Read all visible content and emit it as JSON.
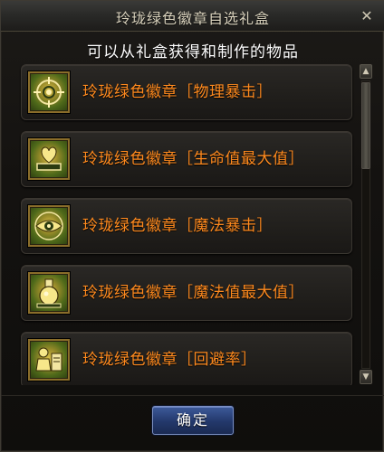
{
  "window": {
    "title": "玲珑绿色徽章自选礼盒",
    "close_glyph": "✕"
  },
  "subtitle": "可以从礼盒获得和制作的物品",
  "items": [
    {
      "label": "玲珑绿色徽章［物理暴击］",
      "icon": "crosshair-icon"
    },
    {
      "label": "玲珑绿色徽章［生命值最大值］",
      "icon": "heart-icon"
    },
    {
      "label": "玲珑绿色徽章［魔法暴击］",
      "icon": "eye-icon"
    },
    {
      "label": "玲珑绿色徽章［魔法值最大值］",
      "icon": "potion-icon"
    },
    {
      "label": "玲珑绿色徽章［回避率］",
      "icon": "figures-icon"
    }
  ],
  "scroll": {
    "up_glyph": "▲",
    "down_glyph": "▼"
  },
  "confirm_button": "确定",
  "colors": {
    "item_text": "#ff8a1e",
    "title_text": "#d9d2bd",
    "button_blue": "#23386b"
  }
}
